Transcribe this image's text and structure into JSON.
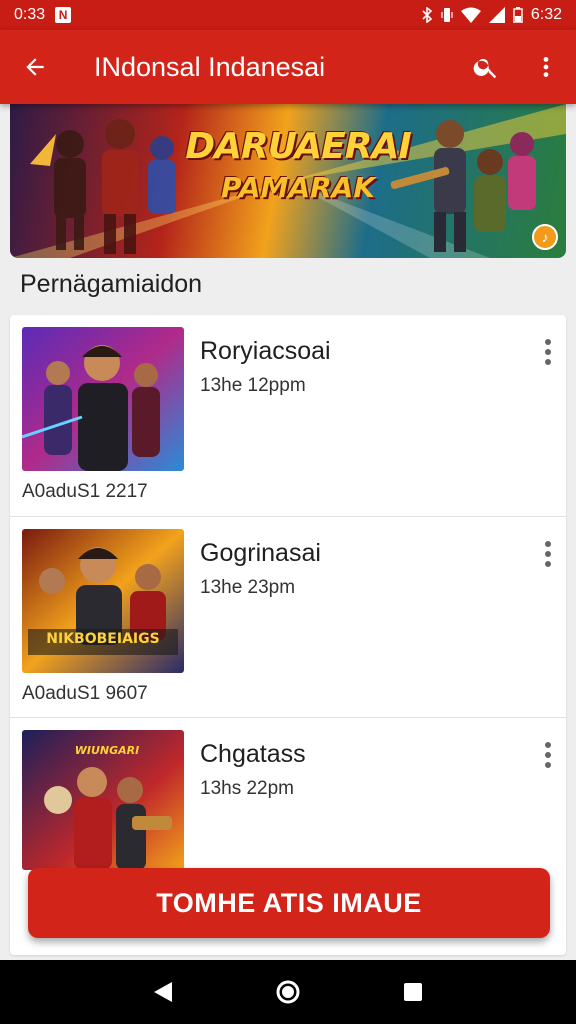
{
  "status_bar": {
    "time": "0:33",
    "notification_letter": "N",
    "battery_time": "6:32"
  },
  "app_bar": {
    "title": "INdonsal Indanesai"
  },
  "banner": {
    "line1": "DARUAERAI",
    "line2": "PAMARAK"
  },
  "section_title": "Pernägamiaidon",
  "items": [
    {
      "title": "Roryiacsoai",
      "time": "13he 12ppm",
      "meta": "A0aduS1  2217",
      "thumb_colors": [
        "#5b2bb6",
        "#e23a5a",
        "#2a8bd8"
      ]
    },
    {
      "title": "Gogrinasai",
      "time": "13he 23pm",
      "meta": "A0aduS1  9607",
      "thumb_colors": [
        "#7a1a10",
        "#f2a21c",
        "#2a2a6a"
      ],
      "thumb_caption": "NIKBOBEIAIGS"
    },
    {
      "title": "Chgatass",
      "time": "13hs 22pm",
      "meta": "",
      "thumb_colors": [
        "#1d1f5a",
        "#c0282a",
        "#f2a21c"
      ],
      "thumb_caption": "WIUNGARI"
    }
  ],
  "cta": {
    "label": "TOMHE ATIS IMAUE"
  },
  "icons": {
    "back": "arrow-left-icon",
    "search": "search-icon",
    "more": "more-vert-icon",
    "nav_back": "nav-back-icon",
    "nav_home": "nav-home-icon",
    "nav_recents": "nav-recents-icon"
  },
  "colors": {
    "primary": "#d3241a",
    "status": "#c81d15",
    "accent": "#f29a19"
  }
}
